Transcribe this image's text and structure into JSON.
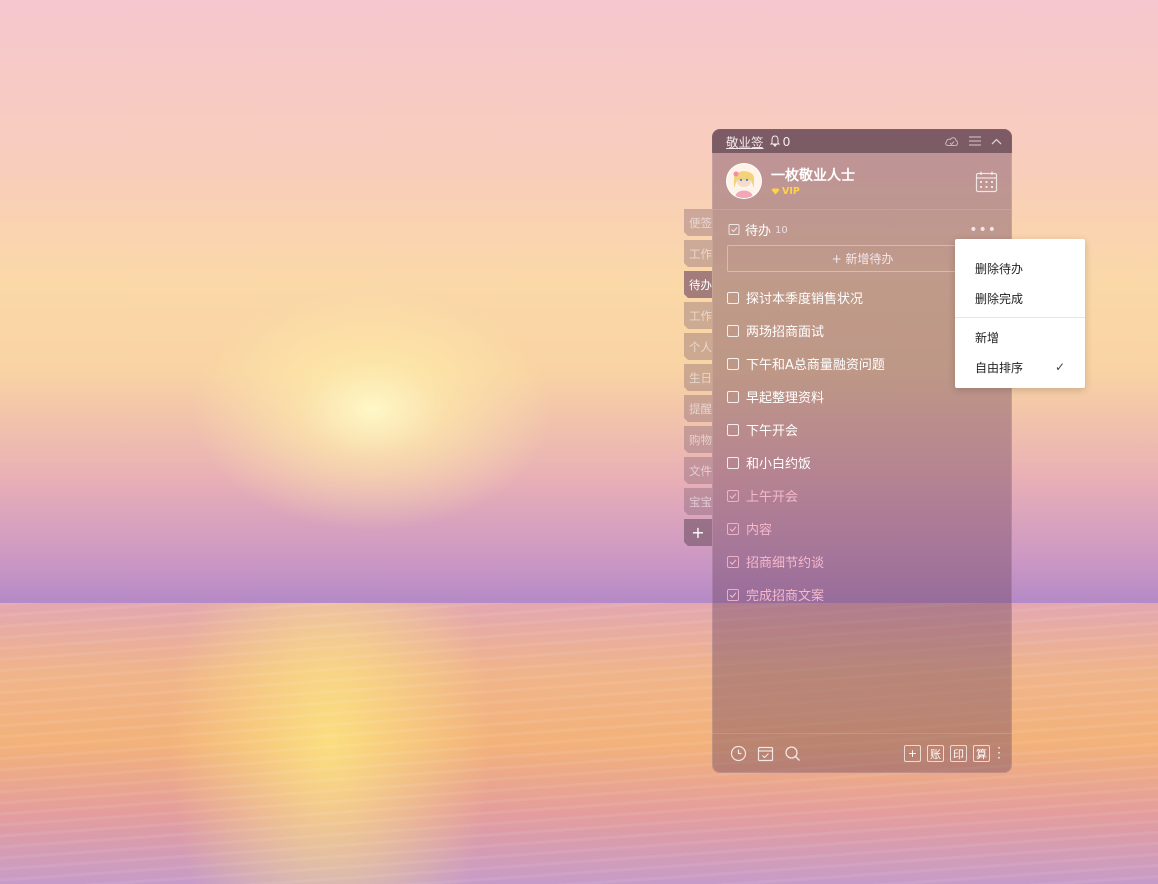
{
  "app": {
    "title": "敬业签",
    "reminder_count": "0"
  },
  "user": {
    "name": "一枚敬业人士",
    "badge": "VIP"
  },
  "side_tabs": [
    {
      "label": "便签",
      "active": false
    },
    {
      "label": "工作",
      "active": false
    },
    {
      "label": "待办",
      "active": true
    },
    {
      "label": "工作",
      "active": false
    },
    {
      "label": "个人",
      "active": false
    },
    {
      "label": "生日",
      "active": false
    },
    {
      "label": "提醒",
      "active": false
    },
    {
      "label": "购物",
      "active": false
    },
    {
      "label": "文件",
      "active": false
    },
    {
      "label": "宝宝",
      "active": false
    }
  ],
  "add_tab_label": "+",
  "todo": {
    "title": "待办",
    "count": "10",
    "more_label": "•••",
    "add_label": "+ 新增待办",
    "items": [
      {
        "text": "探讨本季度销售状况",
        "done": false
      },
      {
        "text": "两场招商面试",
        "done": false
      },
      {
        "text": "下午和A总商量融资问题",
        "done": false
      },
      {
        "text": "早起整理资料",
        "done": false
      },
      {
        "text": "下午开会",
        "done": false
      },
      {
        "text": "和小白约饭",
        "done": false
      },
      {
        "text": "上午开会",
        "done": true
      },
      {
        "text": "内容",
        "done": true
      },
      {
        "text": "招商细节约谈",
        "done": true
      },
      {
        "text": "完成招商文案",
        "done": true
      }
    ]
  },
  "context_menu": {
    "items": [
      {
        "label": "删除待办"
      },
      {
        "label": "删除完成"
      },
      {
        "label": "新增"
      },
      {
        "label": "自由排序",
        "checked": true
      }
    ],
    "check_mark": "✓"
  },
  "bottom_bar": {
    "icons": [
      "clock-icon",
      "calendar-check-icon",
      "search-icon"
    ],
    "buttons": [
      "+",
      "账",
      "印",
      "算"
    ]
  },
  "colors": {
    "menu_bg": "#ffffff",
    "done_text": "#f6b9cb",
    "vip": "#ffd24a"
  }
}
